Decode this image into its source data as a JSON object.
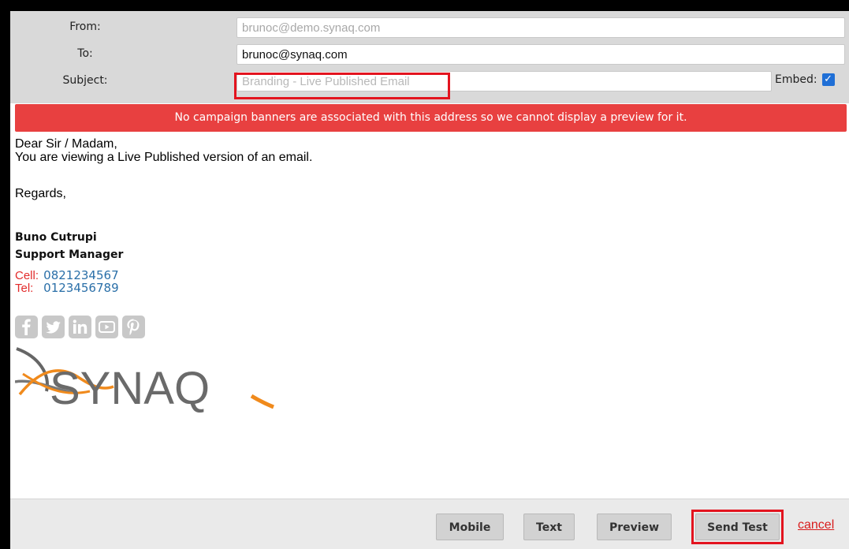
{
  "form": {
    "from_label": "From:",
    "from_value": "brunoc@demo.synaq.com",
    "to_label": "To:",
    "to_value": "brunoc@synaq.com",
    "subject_label": "Subject:",
    "subject_value": "Branding - Live Published Email",
    "embed_label": "Embed:",
    "embed_checked": true
  },
  "banner": {
    "message": "No campaign banners are associated with this address so we cannot display a preview for it.",
    "color": "#e84040"
  },
  "email": {
    "greeting": "Dear Sir / Madam,",
    "line1": "You are viewing a Live Published version of an email.",
    "regards": "Regards,",
    "signature": {
      "name": "Buno Cutrupi",
      "title": "Support Manager",
      "cell_label": "Cell:",
      "cell_value": "0821234567",
      "tel_label": "Tel:",
      "tel_value": "0123456789"
    },
    "social_icons": [
      "facebook-icon",
      "twitter-icon",
      "linkedin-icon",
      "youtube-icon",
      "pinterest-icon"
    ],
    "logo_text": "SYNAQ",
    "logo_accent": "#f08a1c"
  },
  "footer": {
    "mobile_label": "Mobile",
    "text_label": "Text",
    "preview_label": "Preview",
    "send_test_label": "Send Test",
    "cancel_label": "cancel"
  },
  "highlight_color": "#e3141f"
}
